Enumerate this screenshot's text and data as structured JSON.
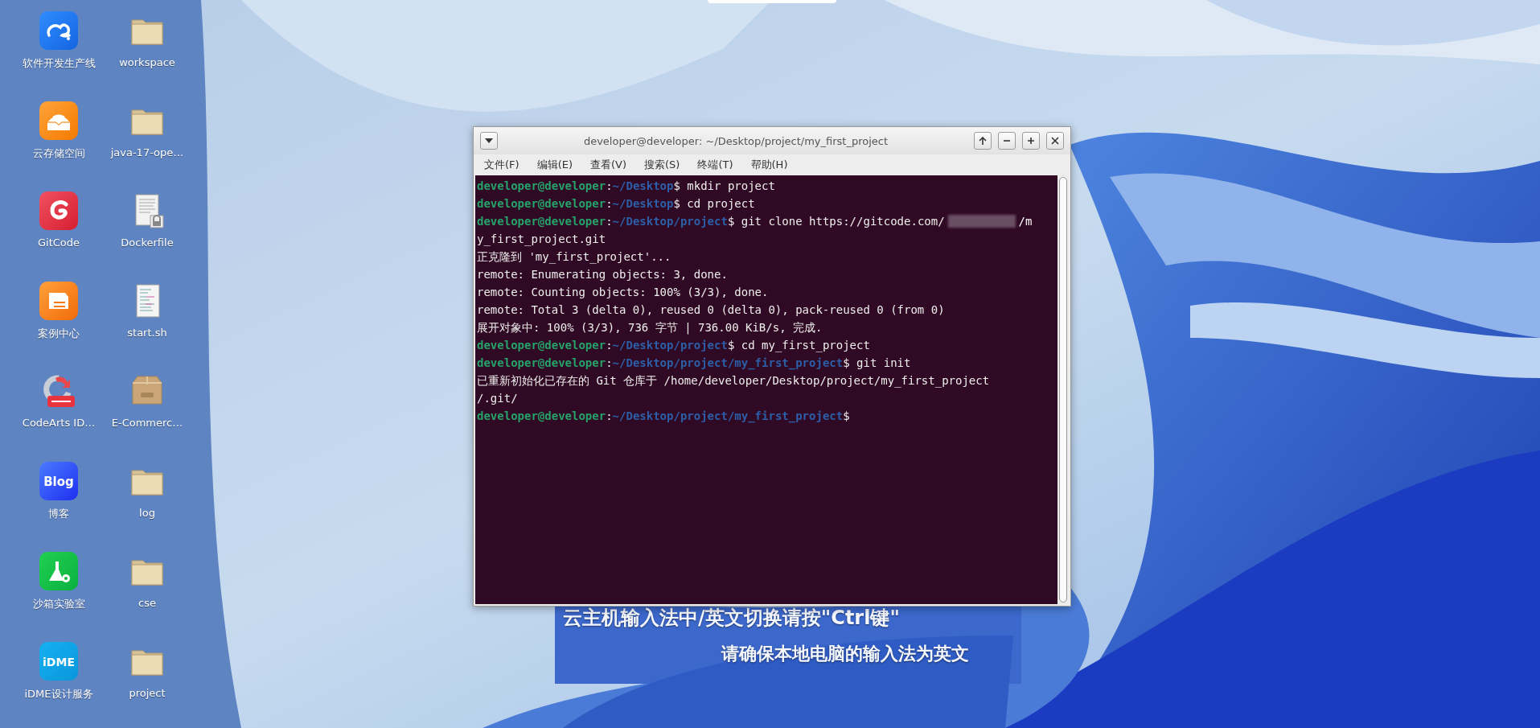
{
  "desktop_icons": [
    {
      "label": "软件开发生产线",
      "kind": "devline"
    },
    {
      "label": "workspace",
      "kind": "folder"
    },
    {
      "label": "云存储空间",
      "kind": "storage"
    },
    {
      "label": "java-17-ope…",
      "kind": "folder"
    },
    {
      "label": "GitCode",
      "kind": "gitcode"
    },
    {
      "label": "Dockerfile",
      "kind": "locked_document"
    },
    {
      "label": "案例中心",
      "kind": "cases"
    },
    {
      "label": "start.sh",
      "kind": "script"
    },
    {
      "label": "CodeArts ID…",
      "kind": "codearts"
    },
    {
      "label": "E-Commerc…",
      "kind": "archive"
    },
    {
      "label": "博客",
      "kind": "blog",
      "badge": "Blog"
    },
    {
      "label": "log",
      "kind": "folder"
    },
    {
      "label": "沙箱实验室",
      "kind": "sandbox"
    },
    {
      "label": "cse",
      "kind": "folder"
    },
    {
      "label": "iDME设计服务",
      "kind": "idme",
      "badge": "iDME"
    },
    {
      "label": "project",
      "kind": "folder"
    }
  ],
  "notice_lines": [
    "云主机输入法中/英文切换请按\"Ctrl键\"",
    "请确保本地电脑的输入法为英文"
  ],
  "terminal": {
    "title": "developer@developer: ~/Desktop/project/my_first_project",
    "menu": [
      "文件(F)",
      "编辑(E)",
      "查看(V)",
      "搜索(S)",
      "终端(T)",
      "帮助(H)"
    ],
    "lines": [
      {
        "kind": "prompt",
        "user": "developer@developer",
        "separator": ":",
        "path": "~/Desktop",
        "command": "$ mkdir project"
      },
      {
        "kind": "prompt",
        "user": "developer@developer",
        "separator": ":",
        "path": "~/Desktop",
        "command": "$ cd project"
      },
      {
        "kind": "prompt",
        "user": "developer@developer",
        "separator": ":",
        "path": "~/Desktop/project",
        "command": "$ git clone https://gitcode.com/",
        "redacted": true,
        "tail": "/m"
      },
      {
        "kind": "output",
        "text": "y_first_project.git"
      },
      {
        "kind": "output",
        "text": "正克隆到 'my_first_project'..."
      },
      {
        "kind": "output",
        "text": "remote: Enumerating objects: 3, done."
      },
      {
        "kind": "output",
        "text": "remote: Counting objects: 100% (3/3), done."
      },
      {
        "kind": "output",
        "text": "remote: Total 3 (delta 0), reused 0 (delta 0), pack-reused 0 (from 0)"
      },
      {
        "kind": "output",
        "text": "展开对象中: 100% (3/3), 736 字节 | 736.00 KiB/s, 完成."
      },
      {
        "kind": "prompt",
        "user": "developer@developer",
        "separator": ":",
        "path": "~/Desktop/project",
        "command": "$ cd my_first_project"
      },
      {
        "kind": "prompt",
        "user": "developer@developer",
        "separator": ":",
        "path": "~/Desktop/project/my_first_project",
        "command": "$ git init"
      },
      {
        "kind": "output",
        "text": "已重新初始化已存在的 Git 仓库于 /home/developer/Desktop/project/my_first_project"
      },
      {
        "kind": "output",
        "text": "/.git/"
      },
      {
        "kind": "prompt",
        "user": "developer@developer",
        "separator": ":",
        "path": "~/Desktop/project/my_first_project",
        "command": "$"
      }
    ]
  }
}
